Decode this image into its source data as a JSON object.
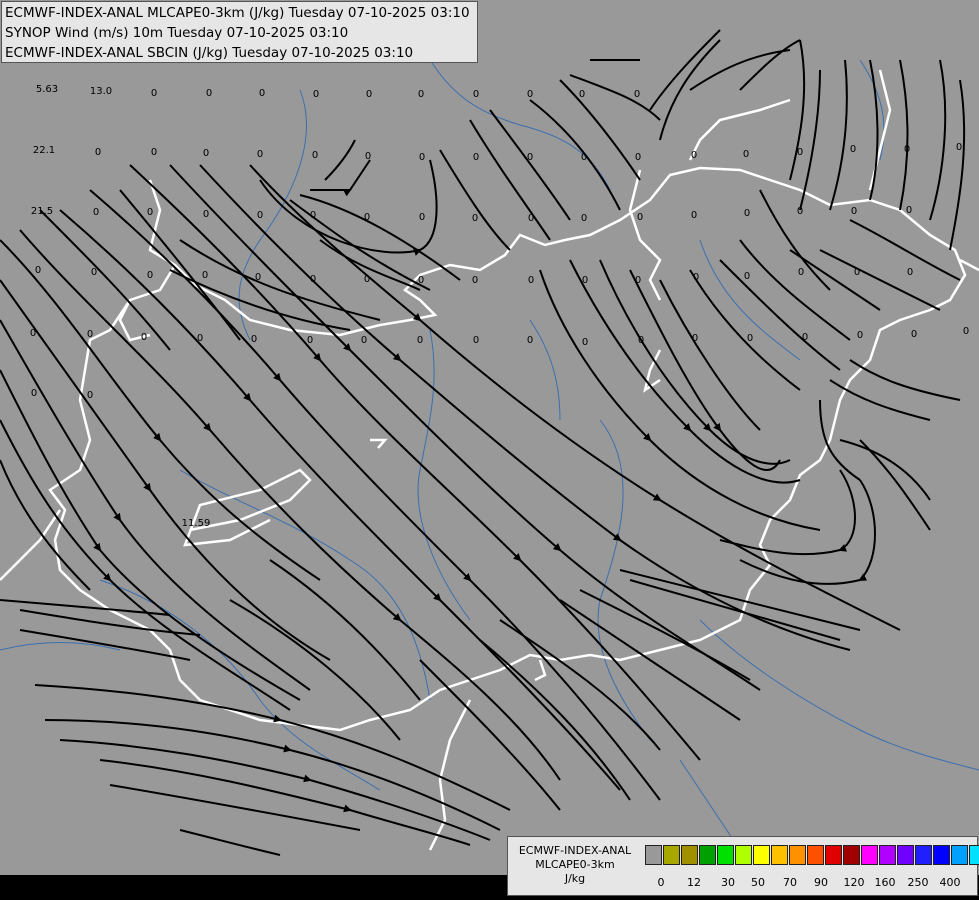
{
  "header": {
    "line1": "ECMWF-INDEX-ANAL MLCAPE0-3km (J/kg) Tuesday 07-10-2025 03:10",
    "line2": "SYNOP Wind (m/s) 10m Tuesday 07-10-2025 03:10",
    "line3": "ECMWF-INDEX-ANAL SBCIN (J/kg) Tuesday 07-10-2025 03:10"
  },
  "legend": {
    "title1": "ECMWF-INDEX-ANAL",
    "title2": "MLCAPE0-3km",
    "title3": "J/kg",
    "colors": [
      "#999999",
      "#a7a700",
      "#a09000",
      "#00a000",
      "#00e000",
      "#b0ff00",
      "#ffff00",
      "#ffc000",
      "#ff9000",
      "#ff5000",
      "#e00000",
      "#a00000",
      "#ff00ff",
      "#b000ff",
      "#7000ff",
      "#2020ff",
      "#0000ff",
      "#00a0ff",
      "#00e0ff",
      "#80ffff",
      "#ffffff"
    ],
    "ticks": [
      "0",
      "12",
      "30",
      "50",
      "70",
      "90",
      "120",
      "160",
      "250",
      "400"
    ]
  },
  "map": {
    "labels": [
      {
        "t": "5.63"
      },
      {
        "t": "13.0"
      },
      {
        "t": "22.1"
      },
      {
        "t": "21.5"
      },
      {
        "t": "11.59"
      },
      {
        "t": "0"
      },
      {
        "t": "0"
      },
      {
        "t": "0"
      },
      {
        "t": "0"
      },
      {
        "t": "0"
      },
      {
        "t": "0"
      },
      {
        "t": "0"
      },
      {
        "t": "0"
      },
      {
        "t": "0"
      },
      {
        "t": "0"
      },
      {
        "t": "0"
      },
      {
        "t": "0"
      },
      {
        "t": "0"
      },
      {
        "t": "0"
      },
      {
        "t": "0"
      },
      {
        "t": "0"
      },
      {
        "t": "0"
      },
      {
        "t": "0"
      },
      {
        "t": "0"
      },
      {
        "t": "0"
      },
      {
        "t": "0"
      },
      {
        "t": "0"
      },
      {
        "t": "0"
      },
      {
        "t": "0"
      },
      {
        "t": "0"
      },
      {
        "t": "0"
      },
      {
        "t": "0"
      },
      {
        "t": "0"
      },
      {
        "t": "0"
      },
      {
        "t": "0"
      },
      {
        "t": "0"
      },
      {
        "t": "0"
      },
      {
        "t": "0"
      },
      {
        "t": "0"
      },
      {
        "t": "0"
      },
      {
        "t": "0"
      },
      {
        "t": "0"
      },
      {
        "t": "0"
      },
      {
        "t": "0"
      },
      {
        "t": "0"
      },
      {
        "t": "0"
      },
      {
        "t": "0"
      },
      {
        "t": "0"
      },
      {
        "t": "0"
      },
      {
        "t": "0"
      },
      {
        "t": "0"
      },
      {
        "t": "0"
      },
      {
        "t": "0"
      },
      {
        "t": "0"
      },
      {
        "t": "0"
      },
      {
        "t": "0"
      },
      {
        "t": "0"
      },
      {
        "t": "0"
      },
      {
        "t": "0"
      },
      {
        "t": "0"
      },
      {
        "t": "0"
      },
      {
        "t": "0"
      },
      {
        "t": "0"
      },
      {
        "t": "0"
      },
      {
        "t": "0"
      },
      {
        "t": "0"
      },
      {
        "t": "0"
      },
      {
        "t": "0"
      },
      {
        "t": "0"
      },
      {
        "t": "0"
      },
      {
        "t": "0"
      },
      {
        "t": "0"
      },
      {
        "t": "0"
      },
      {
        "t": "0"
      },
      {
        "t": "0"
      },
      {
        "t": "0"
      },
      {
        "t": "0"
      },
      {
        "t": "0"
      },
      {
        "t": "0"
      },
      {
        "t": "0"
      },
      {
        "t": "0"
      },
      {
        "t": "0"
      },
      {
        "t": "0"
      },
      {
        "t": "0"
      },
      {
        "t": "0"
      }
    ]
  }
}
